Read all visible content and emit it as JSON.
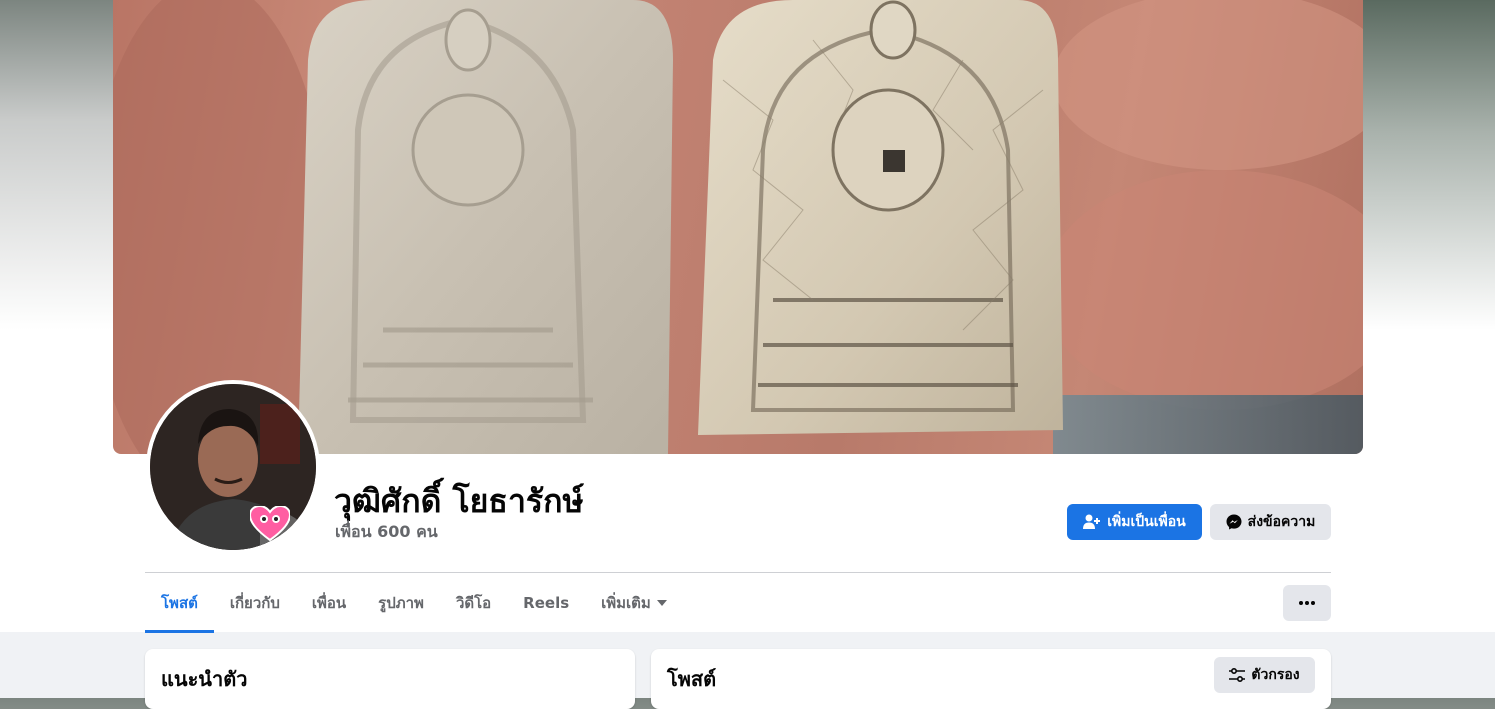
{
  "profile": {
    "name": "วุฒิศักดิ์ โยธารักษ์",
    "friends": "เพื่อน 600 คน"
  },
  "actions": {
    "add_friend": "เพิ่มเป็นเพื่อน",
    "message": "ส่งข้อความ"
  },
  "tabs": [
    {
      "label": "โพสต์",
      "active": true
    },
    {
      "label": "เกี่ยวกับ"
    },
    {
      "label": "เพื่อน"
    },
    {
      "label": "รูปภาพ"
    },
    {
      "label": "วิดีโอ"
    },
    {
      "label": "Reels"
    },
    {
      "label": "เพิ่มเติม"
    }
  ],
  "intro": {
    "title": "แนะนำตัว"
  },
  "posts": {
    "title": "โพสต์",
    "filter_label": "ตัวกรอง"
  },
  "colors": {
    "accent": "#1b74e4",
    "secondary_button": "#e4e6eb",
    "page_bg": "#f0f2f5"
  },
  "icons": {
    "add_friend": "person-plus-icon",
    "message": "messenger-icon",
    "more": "ellipsis-icon",
    "dropdown": "caret-down-icon",
    "filter": "sliders-icon"
  }
}
